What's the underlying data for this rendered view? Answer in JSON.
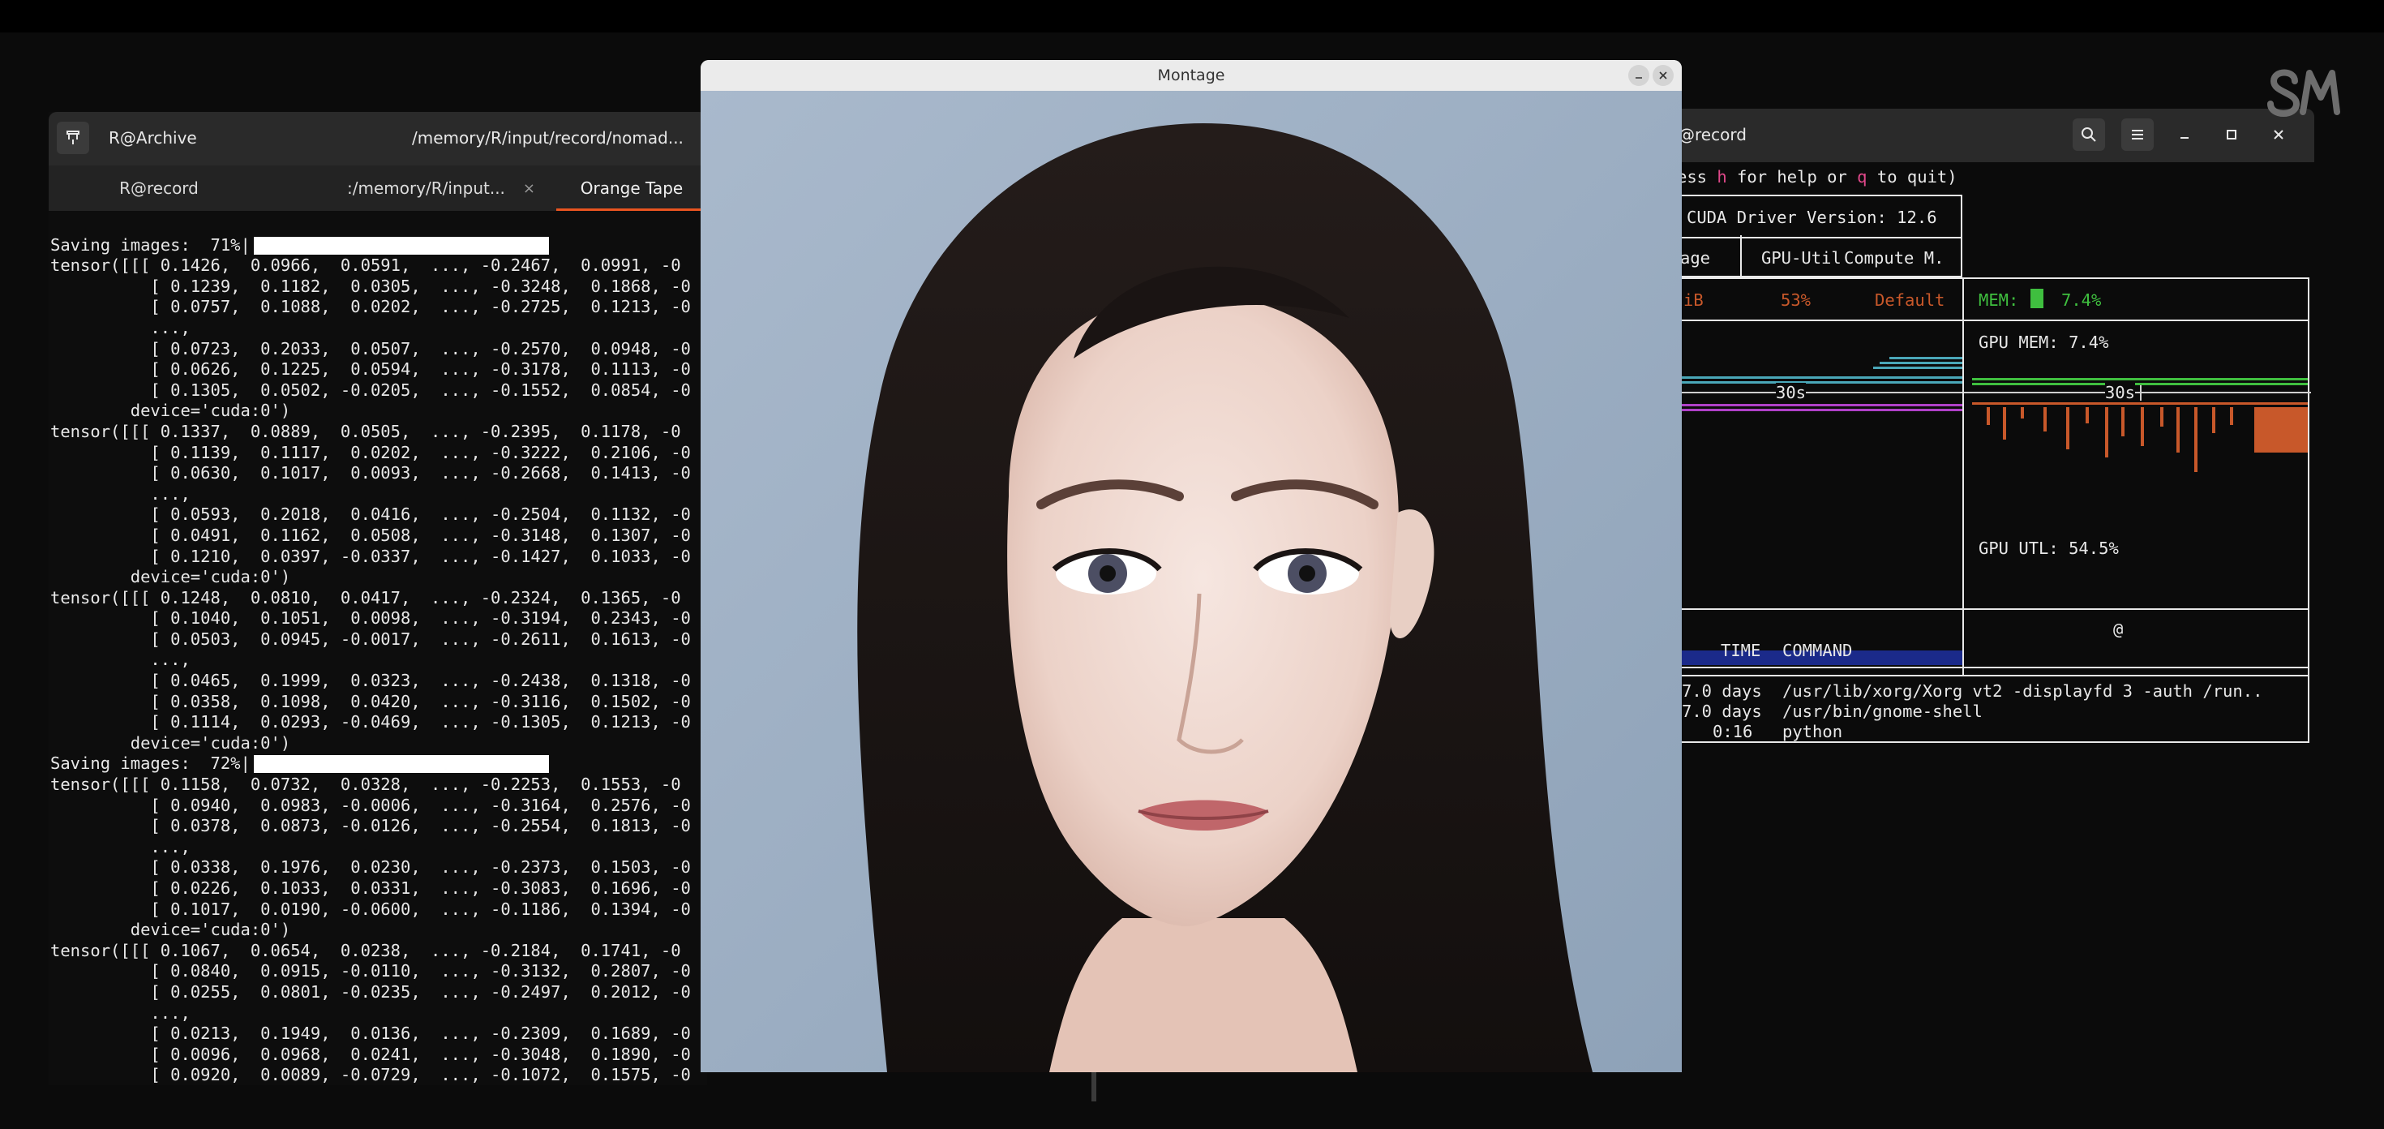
{
  "montage": {
    "title": "Montage"
  },
  "left_terminal": {
    "title_left": "R@Archive",
    "title_path": "/memory/R/input/record/nomad...",
    "tabs": [
      {
        "label": "R@record",
        "closable": false
      },
      {
        "label": ":/memory/R/input...",
        "closable": true,
        "close_glyph": "×"
      },
      {
        "label": "Orange Tape",
        "closable": false,
        "active": true
      }
    ],
    "progress": [
      {
        "label": "Saving images:  71%|",
        "value_percent": 71
      },
      {
        "label": "Saving images:  72%|",
        "value_percent": 72
      }
    ],
    "log_lines": [
      "tensor([[[ 0.1426,  0.0966,  0.0591,  ..., -0.2467,  0.0991, -0",
      "          [ 0.1239,  0.1182,  0.0305,  ..., -0.3248,  0.1868, -0",
      "          [ 0.0757,  0.1088,  0.0202,  ..., -0.2725,  0.1213, -0",
      "          ...,",
      "          [ 0.0723,  0.2033,  0.0507,  ..., -0.2570,  0.0948, -0",
      "          [ 0.0626,  0.1225,  0.0594,  ..., -0.3178,  0.1113, -0",
      "          [ 0.1305,  0.0502, -0.0205,  ..., -0.1552,  0.0854, -0",
      "        device='cuda:0')",
      "tensor([[[ 0.1337,  0.0889,  0.0505,  ..., -0.2395,  0.1178, -0",
      "          [ 0.1139,  0.1117,  0.0202,  ..., -0.3222,  0.2106, -0",
      "          [ 0.0630,  0.1017,  0.0093,  ..., -0.2668,  0.1413, -0",
      "          ...,",
      "          [ 0.0593,  0.2018,  0.0416,  ..., -0.2504,  0.1132, -0",
      "          [ 0.0491,  0.1162,  0.0508,  ..., -0.3148,  0.1307, -0",
      "          [ 0.1210,  0.0397, -0.0337,  ..., -0.1427,  0.1033, -0",
      "        device='cuda:0')",
      "tensor([[[ 0.1248,  0.0810,  0.0417,  ..., -0.2324,  0.1365, -0",
      "          [ 0.1040,  0.1051,  0.0098,  ..., -0.3194,  0.2343, -0",
      "          [ 0.0503,  0.0945, -0.0017,  ..., -0.2611,  0.1613, -0",
      "          ...,",
      "          [ 0.0465,  0.1999,  0.0323,  ..., -0.2438,  0.1318, -0",
      "          [ 0.0358,  0.1098,  0.0420,  ..., -0.3116,  0.1502, -0",
      "          [ 0.1114,  0.0293, -0.0469,  ..., -0.1305,  0.1213, -0",
      "        device='cuda:0')"
    ],
    "log_lines_2": [
      "tensor([[[ 0.1158,  0.0732,  0.0328,  ..., -0.2253,  0.1553, -0",
      "          [ 0.0940,  0.0983, -0.0006,  ..., -0.3164,  0.2576, -0",
      "          [ 0.0378,  0.0873, -0.0126,  ..., -0.2554,  0.1813, -0",
      "          ...,",
      "          [ 0.0338,  0.1976,  0.0230,  ..., -0.2373,  0.1503, -0",
      "          [ 0.0226,  0.1033,  0.0331,  ..., -0.3083,  0.1696, -0",
      "          [ 0.1017,  0.0190, -0.0600,  ..., -0.1186,  0.1394, -0",
      "        device='cuda:0')",
      "tensor([[[ 0.1067,  0.0654,  0.0238,  ..., -0.2184,  0.1741, -0",
      "          [ 0.0840,  0.0915, -0.0110,  ..., -0.3132,  0.2807, -0",
      "          [ 0.0255,  0.0801, -0.0235,  ..., -0.2497,  0.2012, -0",
      "          ...,",
      "          [ 0.0213,  0.1949,  0.0136,  ..., -0.2309,  0.1689, -0",
      "          [ 0.0096,  0.0968,  0.0241,  ..., -0.3048,  0.1890, -0",
      "          [ 0.0920,  0.0089, -0.0729,  ..., -0.1072,  0.1575, -0",
      "        device='cuda:0')"
    ]
  },
  "right_terminal": {
    "title": "@record",
    "help_line_pre": "ess ",
    "help_h": "h",
    "help_mid": " for help or ",
    "help_q": "q",
    "help_post": " to quit)",
    "cuda_driver": "CUDA Driver Version: 12.6",
    "col_age": "age",
    "col_gpu_util": "GPU-Util",
    "col_compute": "Compute M.",
    "row_mem_partial": "iB",
    "row_util": "53%",
    "row_compute": "Default",
    "mem_label": "MEM:",
    "mem_value": "7.4%",
    "gpu_mem_label": "GPU MEM: 7.4%",
    "gpu_utl_label": "GPU UTL: 54.5%",
    "time_marker": "30s",
    "proc_marker": "@",
    "proc_header_time": "TIME",
    "proc_header_cmd": "COMMAND",
    "processes": [
      {
        "time": "7.0 days",
        "command": "/usr/lib/xorg/Xorg vt2 -displayfd 3 -auth /run.."
      },
      {
        "time": "7.0 days",
        "command": "/usr/bin/gnome-shell"
      },
      {
        "time": "0:16",
        "command": "python"
      }
    ],
    "colors": {
      "mem_bar": "#3fbf3f",
      "util": "#c8582a",
      "help_keys": "#e0488a"
    }
  },
  "icons": {
    "pin": "pin-icon",
    "search": "search-icon",
    "menu": "hamburger-menu-icon",
    "minimize": "minimize-icon",
    "maximize": "maximize-icon",
    "close": "close-icon",
    "logo": "sm-logo-icon"
  }
}
